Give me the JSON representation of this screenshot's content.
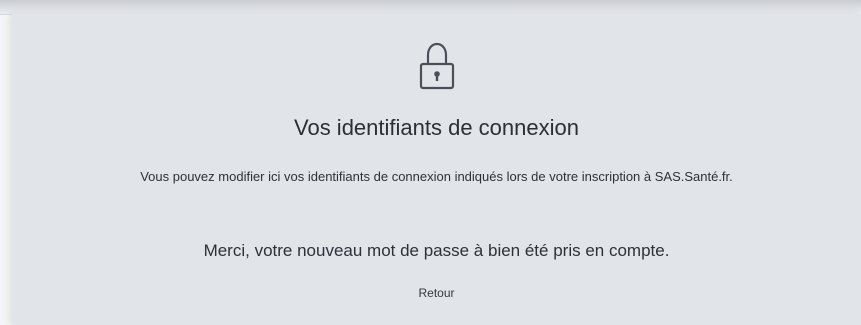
{
  "header": {
    "icon": "lock-icon",
    "title": "Vos identifiants de connexion",
    "subtitle": "Vous pouvez modifier ici vos identifiants de connexion indiqués lors de votre inscription à SAS.Santé.fr."
  },
  "message": {
    "text": "Merci, votre nouveau mot de passe à bien été pris en compte."
  },
  "actions": {
    "back_label": "Retour"
  },
  "colors": {
    "card_background": "#e1e5ea",
    "text": "#2b2f36"
  }
}
